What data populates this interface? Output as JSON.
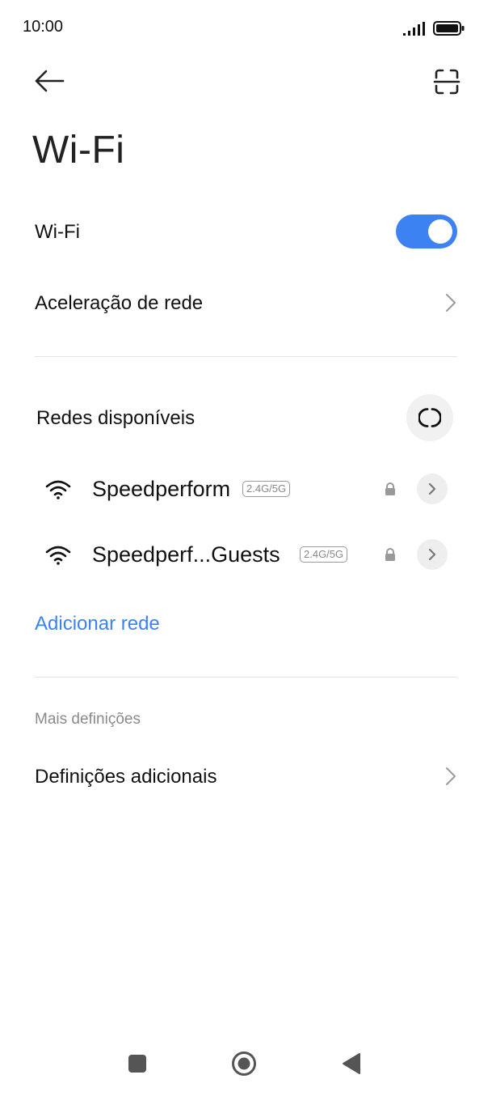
{
  "status_bar": {
    "time": "10:00",
    "signal_icon": "signal-icon",
    "battery_icon": "battery-icon"
  },
  "header": {
    "back_icon": "arrow-left-icon",
    "scan_icon": "qr-scan-icon",
    "title": "Wi-Fi"
  },
  "wifi_toggle": {
    "label": "Wi-Fi",
    "state": "on",
    "accent_color": "#3d82f3"
  },
  "network_acceleration": {
    "label": "Aceleração de rede"
  },
  "available_networks": {
    "section_label": "Redes disponíveis",
    "refresh_icon": "refresh-icon",
    "networks": [
      {
        "name": "Speedperform",
        "band": "2.4G/5G",
        "secured": true
      },
      {
        "name": "Speedperf...Guests",
        "band": "2.4G/5G",
        "secured": true
      }
    ]
  },
  "add_network": {
    "label": "Adicionar rede"
  },
  "more_settings": {
    "section_label": "Mais definições",
    "additional_settings_label": "Definições adicionais"
  },
  "nav_bar": {
    "recents_icon": "square-icon",
    "home_icon": "circle-icon",
    "back_icon": "triangle-back-icon"
  }
}
